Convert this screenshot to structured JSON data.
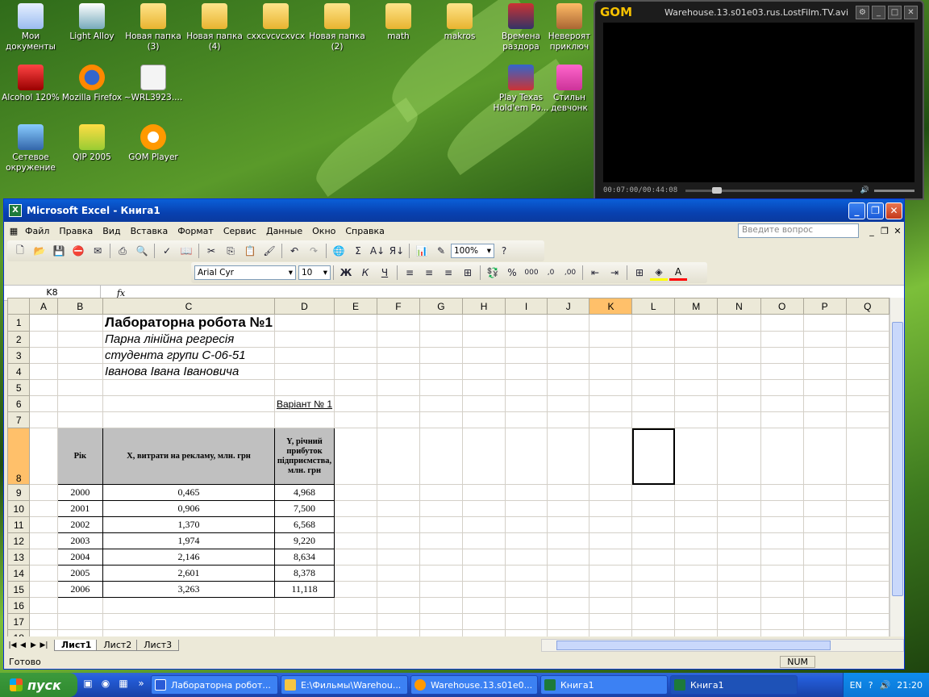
{
  "desktop": {
    "icons": [
      {
        "label": "Мои документы"
      },
      {
        "label": "Light Alloy"
      },
      {
        "label": "Новая папка (3)"
      },
      {
        "label": "Новая папка (4)"
      },
      {
        "label": "cxxcvcvcxvcx"
      },
      {
        "label": "Новая папка (2)"
      },
      {
        "label": "math"
      },
      {
        "label": "makros"
      },
      {
        "label": "Времена раздора"
      },
      {
        "label": "Невероят приключ"
      },
      {
        "label": "Alcohol 120%"
      },
      {
        "label": "Mozilla Firefox"
      },
      {
        "label": "~WRL3923...."
      },
      {
        "label": "Play Texas Hold'em Po..."
      },
      {
        "label": "Стильн девчонк"
      },
      {
        "label": "Сетевое окружение"
      },
      {
        "label": "QIP 2005"
      },
      {
        "label": "GOM Player"
      }
    ]
  },
  "gom": {
    "logo": "GOM",
    "title": "Warehouse.13.s01e03.rus.LostFilm.TV.avi",
    "time": "00:07:00/00:44:08",
    "progress": 0.16
  },
  "excel": {
    "title": "Microsoft Excel - Книга1",
    "menu": [
      "Файл",
      "Правка",
      "Вид",
      "Вставка",
      "Формат",
      "Сервис",
      "Данные",
      "Окно",
      "Справка"
    ],
    "ask_placeholder": "Введите вопрос",
    "zoom": "100%",
    "font_name": "Arial Cyr",
    "font_size": "10",
    "name_box": "K8",
    "fx": "fx",
    "columns": [
      "A",
      "B",
      "C",
      "D",
      "E",
      "F",
      "G",
      "H",
      "I",
      "J",
      "K",
      "L",
      "M",
      "N",
      "O",
      "P",
      "Q"
    ],
    "selected_col": "K",
    "selected_row": "8",
    "cells": {
      "title": "Лабораторна робота №1",
      "subtitle1": "Парна лінійна регресія",
      "subtitle2": "студента групи С-06-51",
      "subtitle3": "Іванова Івана Івановича",
      "variant": "Варіант № 1"
    },
    "table_headers": [
      "Рік",
      "X, витрати на рекламу, млн. грн",
      "Y, річний прибуток підприємства, млн. грн"
    ],
    "table_rows": [
      [
        "2000",
        "0,465",
        "4,968"
      ],
      [
        "2001",
        "0,906",
        "7,500"
      ],
      [
        "2002",
        "1,370",
        "6,568"
      ],
      [
        "2003",
        "1,974",
        "9,220"
      ],
      [
        "2004",
        "2,146",
        "8,634"
      ],
      [
        "2005",
        "2,601",
        "8,378"
      ],
      [
        "2006",
        "3,263",
        "11,118"
      ]
    ],
    "sheets": [
      "Лист1",
      "Лист2",
      "Лист3"
    ],
    "active_sheet": "Лист1",
    "status": "Готово",
    "num": "NUM"
  },
  "taskbar": {
    "start": "пуск",
    "tasks": [
      {
        "label": "Лабораторна робот..."
      },
      {
        "label": "E:\\Фильмы\\Warehou..."
      },
      {
        "label": "Warehouse.13.s01e0..."
      },
      {
        "label": "Книга1"
      },
      {
        "label": "Книга1"
      }
    ],
    "lang": "EN",
    "clock": "21:20"
  }
}
